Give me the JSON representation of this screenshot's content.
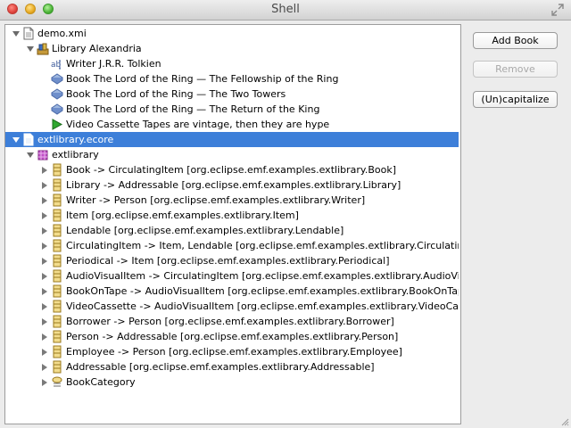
{
  "window": {
    "title": "Shell"
  },
  "tree": {
    "rows": [
      {
        "label": "demo.xmi",
        "indent": 0,
        "expander": "expanded",
        "icon": "xmi-file-icon",
        "selected": false
      },
      {
        "label": "Library Alexandria",
        "indent": 1,
        "expander": "expanded",
        "icon": "library-icon",
        "selected": false
      },
      {
        "label": "Writer J.R.R. Tolkien",
        "indent": 2,
        "expander": "none",
        "icon": "writer-icon",
        "selected": false
      },
      {
        "label": "Book The Lord of the Ring — The Fellowship of the Ring",
        "indent": 2,
        "expander": "none",
        "icon": "book-icon",
        "selected": false
      },
      {
        "label": "Book The Lord of the Ring — The Two Towers",
        "indent": 2,
        "expander": "none",
        "icon": "book-icon",
        "selected": false
      },
      {
        "label": "Book The Lord of the Ring — The Return of the King",
        "indent": 2,
        "expander": "none",
        "icon": "book-icon",
        "selected": false
      },
      {
        "label": "Video Cassette Tapes are vintage, then they are hype",
        "indent": 2,
        "expander": "none",
        "icon": "video-cassette-icon",
        "selected": false
      },
      {
        "label": "extlibrary.ecore",
        "indent": 0,
        "expander": "expanded",
        "icon": "ecore-file-icon",
        "selected": true
      },
      {
        "label": "extlibrary",
        "indent": 1,
        "expander": "expanded",
        "icon": "package-icon",
        "selected": false
      },
      {
        "label": "Book -> CirculatingItem [org.eclipse.emf.examples.extlibrary.Book]",
        "indent": 2,
        "expander": "collapsed",
        "icon": "eclass-icon",
        "selected": false
      },
      {
        "label": "Library -> Addressable [org.eclipse.emf.examples.extlibrary.Library]",
        "indent": 2,
        "expander": "collapsed",
        "icon": "eclass-icon",
        "selected": false
      },
      {
        "label": "Writer -> Person [org.eclipse.emf.examples.extlibrary.Writer]",
        "indent": 2,
        "expander": "collapsed",
        "icon": "eclass-icon",
        "selected": false
      },
      {
        "label": "Item [org.eclipse.emf.examples.extlibrary.Item]",
        "indent": 2,
        "expander": "collapsed",
        "icon": "eclass-icon",
        "selected": false
      },
      {
        "label": "Lendable [org.eclipse.emf.examples.extlibrary.Lendable]",
        "indent": 2,
        "expander": "collapsed",
        "icon": "eclass-icon",
        "selected": false
      },
      {
        "label": "CirculatingItem -> Item, Lendable [org.eclipse.emf.examples.extlibrary.CirculatingItem]",
        "indent": 2,
        "expander": "collapsed",
        "icon": "eclass-icon",
        "selected": false
      },
      {
        "label": "Periodical -> Item [org.eclipse.emf.examples.extlibrary.Periodical]",
        "indent": 2,
        "expander": "collapsed",
        "icon": "eclass-icon",
        "selected": false
      },
      {
        "label": "AudioVisualItem -> CirculatingItem [org.eclipse.emf.examples.extlibrary.AudioVisualItem]",
        "indent": 2,
        "expander": "collapsed",
        "icon": "eclass-icon",
        "selected": false
      },
      {
        "label": "BookOnTape -> AudioVisualItem [org.eclipse.emf.examples.extlibrary.BookOnTape]",
        "indent": 2,
        "expander": "collapsed",
        "icon": "eclass-icon",
        "selected": false
      },
      {
        "label": "VideoCassette -> AudioVisualItem [org.eclipse.emf.examples.extlibrary.VideoCassette]",
        "indent": 2,
        "expander": "collapsed",
        "icon": "eclass-icon",
        "selected": false
      },
      {
        "label": "Borrower -> Person [org.eclipse.emf.examples.extlibrary.Borrower]",
        "indent": 2,
        "expander": "collapsed",
        "icon": "eclass-icon",
        "selected": false
      },
      {
        "label": "Person -> Addressable [org.eclipse.emf.examples.extlibrary.Person]",
        "indent": 2,
        "expander": "collapsed",
        "icon": "eclass-icon",
        "selected": false
      },
      {
        "label": "Employee -> Person [org.eclipse.emf.examples.extlibrary.Employee]",
        "indent": 2,
        "expander": "collapsed",
        "icon": "eclass-icon",
        "selected": false
      },
      {
        "label": "Addressable [org.eclipse.emf.examples.extlibrary.Addressable]",
        "indent": 2,
        "expander": "collapsed",
        "icon": "eclass-icon",
        "selected": false
      },
      {
        "label": "BookCategory",
        "indent": 2,
        "expander": "collapsed",
        "icon": "eenum-icon",
        "selected": false
      }
    ]
  },
  "buttons": {
    "add_book": {
      "label": "Add Book",
      "enabled": true
    },
    "remove": {
      "label": "Remove",
      "enabled": false
    },
    "uncapitalize": {
      "label": "(Un)capitalize",
      "enabled": true
    }
  },
  "colors": {
    "selection": "#3d7fd9",
    "window_bg": "#ececec"
  }
}
